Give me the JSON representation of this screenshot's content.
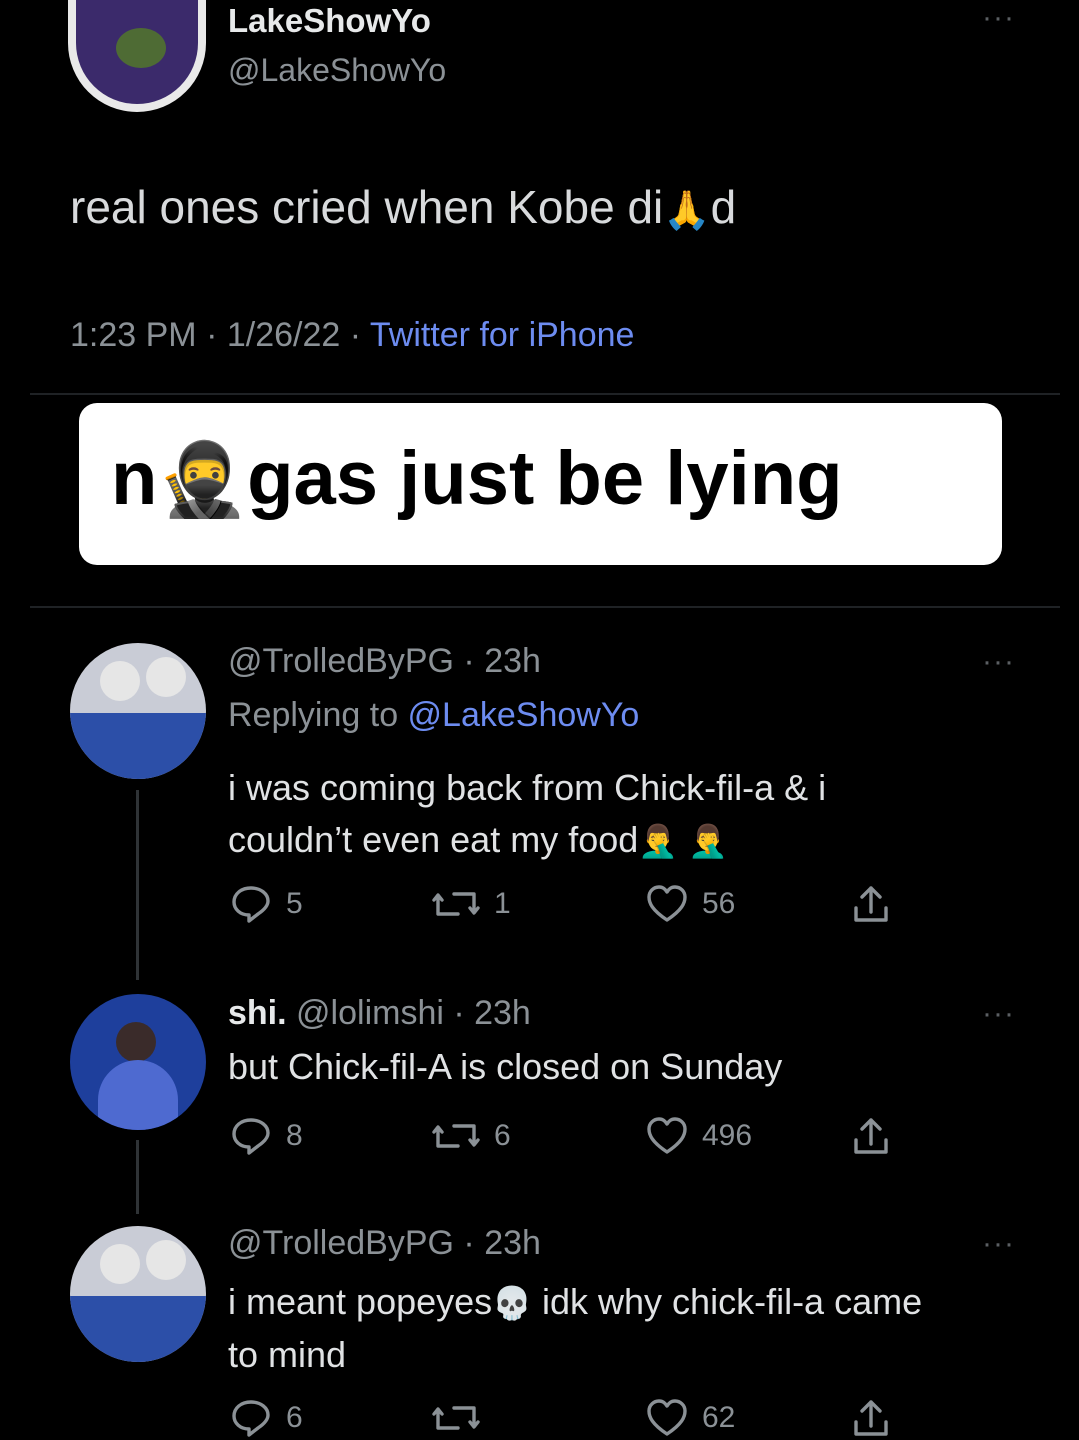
{
  "main_tweet": {
    "display_name": "LakeShowYo",
    "handle": "@LakeShowYo",
    "text": "real ones cried when Kobe di",
    "text_emoji": "🙏",
    "text_end": "d",
    "time": "1:23 PM · 1/26/22 · ",
    "source": "Twitter for iPhone"
  },
  "caption": {
    "prefix": "n",
    "emoji": "🥷",
    "text": "gas just be lying"
  },
  "replies": [
    {
      "handle_line": "@TrolledByPG · 23h",
      "replying_prefix": "Replying to ",
      "replying_handle": "@LakeShowYo",
      "text_line1": "i was coming back from Chick-fil-a & i",
      "text_line2": "couldn’t even eat my food",
      "text_emoji": "🤦‍♂️ 🤦‍♂️",
      "reply_count": "5",
      "retweet_count": "1",
      "like_count": "56"
    },
    {
      "display_name": "shi.",
      "handle_line": "@lolimshi · 23h",
      "text_line1": "but Chick-fil-A is closed on Sunday",
      "reply_count": "8",
      "retweet_count": "6",
      "like_count": "496"
    },
    {
      "handle_line": "@TrolledByPG · 23h",
      "text_line1a": "i meant popeyes",
      "text_emoji": "💀",
      "text_line1b": " idk why chick-fil-a came",
      "text_line2": "to mind",
      "reply_count": "6",
      "like_count": "62"
    }
  ],
  "icons": [
    "reply-icon",
    "retweet-icon",
    "like-icon",
    "share-icon",
    "more-icon"
  ],
  "colors": {
    "background": "#000000",
    "link": "#6d8cf0",
    "muted": "#8b9196",
    "caption_bg": "#ffffff"
  }
}
